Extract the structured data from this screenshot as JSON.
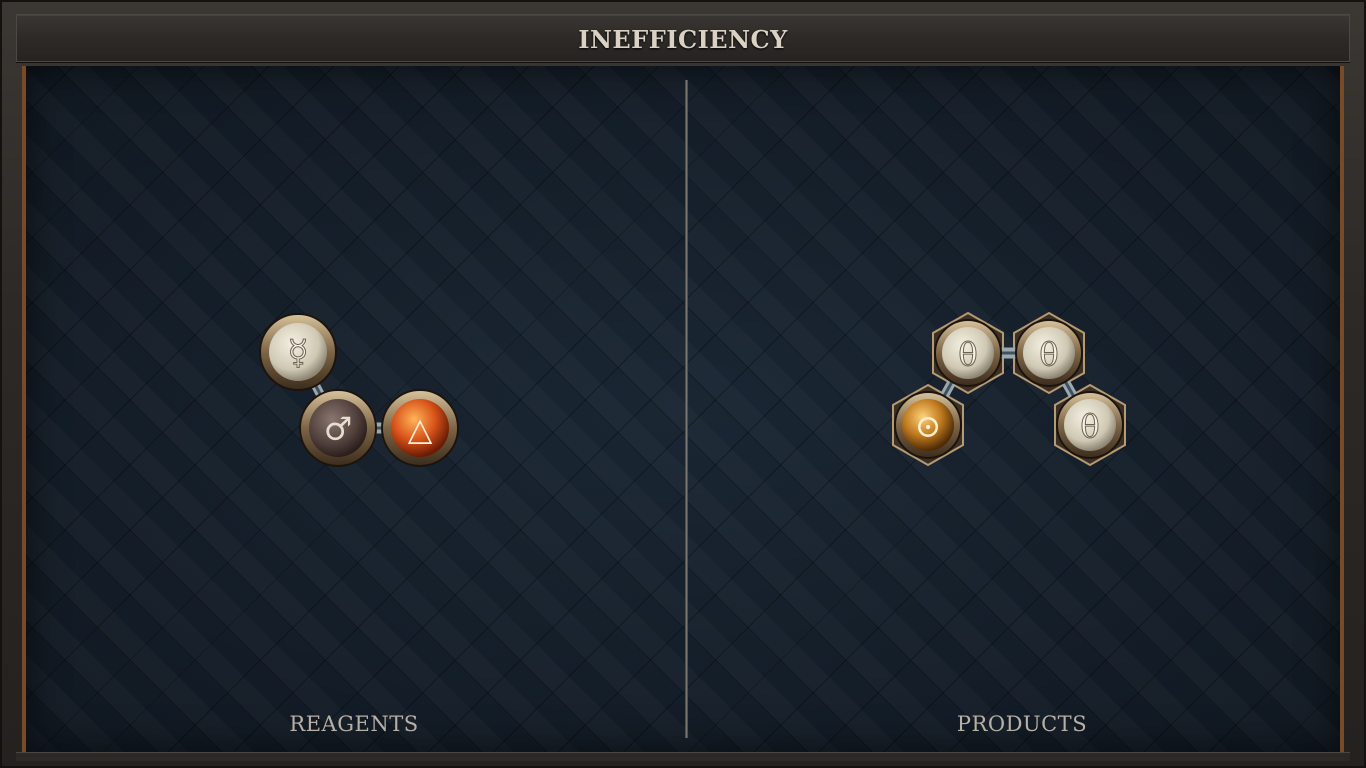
{
  "title": "INEFFICIENCY",
  "reagents": {
    "label": "REAGENTS",
    "atoms": [
      {
        "symbol": "☿",
        "element": "quicksilver",
        "color": "#d8d2bf"
      },
      {
        "symbol": "♂",
        "element": "iron",
        "color": "#5e4d48"
      },
      {
        "symbol": "△",
        "element": "fire",
        "color": "#d9541a"
      }
    ]
  },
  "products": {
    "label": "PRODUCTS",
    "atoms": [
      {
        "symbol": "⊙",
        "element": "gold",
        "color": "#c07a1f"
      },
      {
        "symbol": "θ",
        "element": "salt",
        "color": "#d8d2bf"
      },
      {
        "symbol": "θ",
        "element": "salt",
        "color": "#d8d2bf"
      },
      {
        "symbol": "θ",
        "element": "salt",
        "color": "#d8d2bf"
      }
    ]
  },
  "colors": {
    "frame": "#2d2a27",
    "board": "#121b25",
    "accent_border": "#7a4a26",
    "title_text": "#d9d2c4",
    "label_text": "#b7b0a6"
  }
}
